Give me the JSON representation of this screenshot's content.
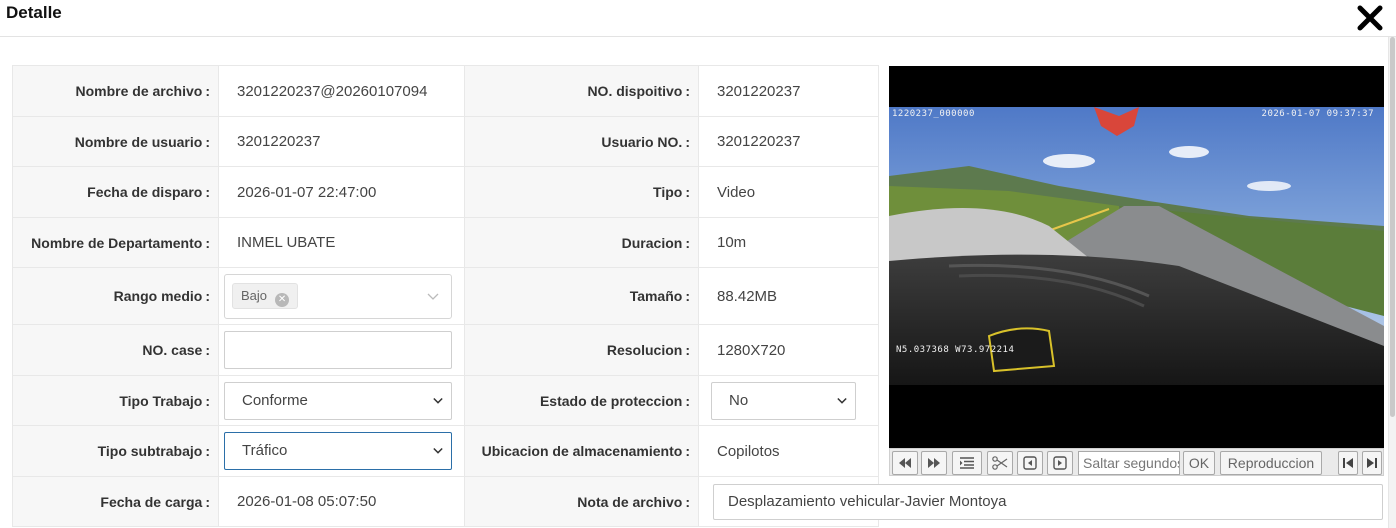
{
  "dialog": {
    "title": "Detalle"
  },
  "form": {
    "rows": [
      {
        "left_label": "Nombre de archivo",
        "left_value": "3201220237@20260107094",
        "right_label": "NO. dispoitivo",
        "right_value": "3201220237"
      },
      {
        "left_label": "Nombre de usuario",
        "left_value": "3201220237",
        "right_label": "Usuario NO.",
        "right_value": "3201220237"
      },
      {
        "left_label": "Fecha de disparo",
        "left_value": "2026-01-07 22:47:00",
        "right_label": "Tipo",
        "right_value": "Video"
      },
      {
        "left_label": "Nombre de Departamento",
        "left_value": "INMEL UBATE",
        "right_label": "Duracion",
        "right_value": "10m"
      },
      {
        "left_label": "Rango medio",
        "left_value": "Bajo",
        "right_label": "Tamaño",
        "right_value": "88.42MB"
      },
      {
        "left_label": "NO. case",
        "left_value": "",
        "right_label": "Resolucion",
        "right_value": "1280X720"
      },
      {
        "left_label": "Tipo Trabajo",
        "left_value": "Conforme",
        "right_label": "Estado de proteccion",
        "right_value": "No"
      },
      {
        "left_label": "Tipo subtrabajo",
        "left_value": "Tráfico",
        "right_label": "Ubicacion de almacenamiento",
        "right_value": "Copilotos"
      },
      {
        "left_label": "Fecha de carga",
        "left_value": "2026-01-08 05:07:50",
        "right_label": "Nota de archivo",
        "right_value": "Desplazamiento vehicular-Javier Montoya"
      }
    ],
    "colon": ":"
  },
  "video": {
    "osd_channel": "1220237_000000",
    "osd_datetime": "2026-01-07 09:37:37",
    "osd_gps": "N5.037368  W73.972214"
  },
  "player_controls": {
    "seek_placeholder": "Saltar segundos",
    "ok_label": "OK",
    "playback_label": "Reproduccion",
    "icons": [
      "rewind-icon",
      "fast-forward-icon",
      "playlist-icon",
      "scissors-icon",
      "prev-frame-icon",
      "next-frame-icon",
      "skip-start-icon",
      "skip-end-icon"
    ]
  },
  "colors": {
    "border": "#e8e8e8",
    "label_bg": "#f7f7f7",
    "active_select": "#2b6fa8"
  }
}
